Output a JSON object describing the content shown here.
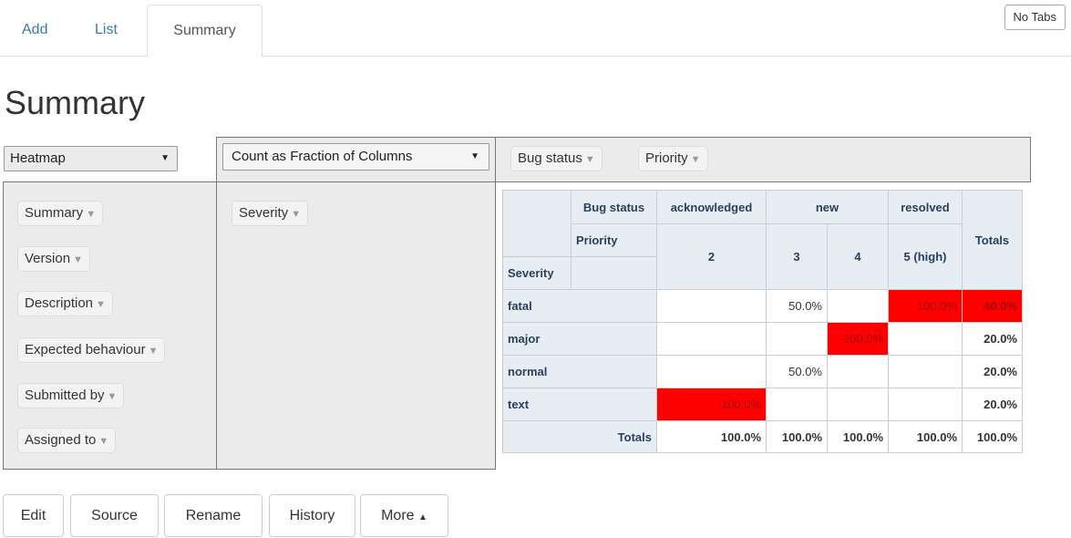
{
  "tabs": [
    {
      "label": "Add"
    },
    {
      "label": "List"
    },
    {
      "label": "Summary"
    }
  ],
  "no_tabs_label": "No Tabs",
  "page_title": "Summary",
  "renderer": {
    "selected": "Heatmap"
  },
  "aggregator": {
    "selected": "Count as Fraction of Columns"
  },
  "col_attrs": [
    "Bug status",
    "Priority"
  ],
  "row_attrs": [
    "Severity"
  ],
  "unused_attrs": [
    "Summary",
    "Version",
    "Description",
    "Expected behaviour",
    "Submitted by",
    "Assigned to"
  ],
  "table": {
    "col_header_1": "Bug status",
    "col_header_2": "Priority",
    "row_header": "Severity",
    "status_groups": [
      "acknowledged",
      "new",
      "resolved"
    ],
    "priorities": [
      "2",
      "3",
      "4",
      "5 (high)"
    ],
    "totals_label": "Totals",
    "rows": [
      {
        "label": "fatal",
        "cells": [
          "",
          "50.0%",
          "",
          "100.0%"
        ],
        "total": "40.0%"
      },
      {
        "label": "major",
        "cells": [
          "",
          "",
          "100.0%",
          ""
        ],
        "total": "20.0%"
      },
      {
        "label": "normal",
        "cells": [
          "",
          "50.0%",
          "",
          ""
        ],
        "total": "20.0%"
      },
      {
        "label": "text",
        "cells": [
          "100.0%",
          "",
          "",
          ""
        ],
        "total": "20.0%"
      }
    ],
    "col_totals": [
      "100.0%",
      "100.0%",
      "100.0%",
      "100.0%"
    ],
    "grand_total": "100.0%"
  },
  "heat_color": "#ff0000",
  "buttons": {
    "edit": "Edit",
    "source": "Source",
    "rename": "Rename",
    "history": "History",
    "more": "More"
  }
}
